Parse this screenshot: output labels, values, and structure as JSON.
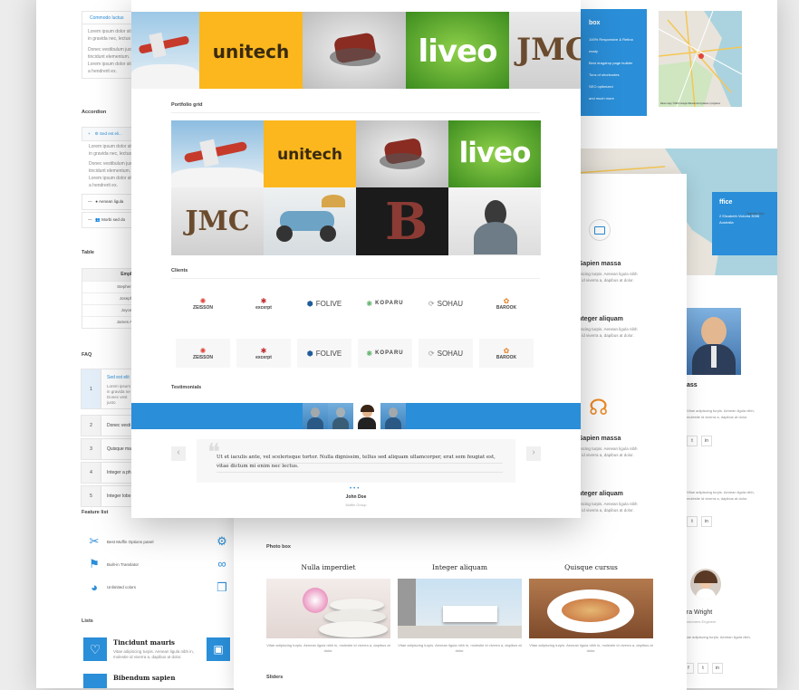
{
  "back_left": {
    "tab_label": "Commodo luctus",
    "tab_text_1": "Lorem ipsum dolor sit amet,",
    "tab_text_2": "in gravida nec, lectus",
    "tab_text_3": "Donec vestibulum justo",
    "tab_text_4": "tincidunt elementum.",
    "tab_text_5": "Lorem ipsum dolor sit",
    "tab_text_6": "a hendrerit ex.",
    "accordion_title": "Accordion",
    "accordion_item_1": "Sed est eli...",
    "accordion_text_1": "Lorem ipsum dolor sit",
    "accordion_text_2": "in gravida nec, lectus",
    "accordion_text_3": "Donec vestibulum justo",
    "accordion_text_4": "tincidunt elementum. Sl",
    "accordion_text_5": "Lorem ipsum dolor sit",
    "accordion_text_6": "a hendrerit ex.",
    "accordion_item_2": "Aenean ligula",
    "accordion_item_3": "Morbi sed do",
    "table_title": "Table",
    "table_header": "Employee",
    "table_rows": [
      "Stephen C. Cox",
      "Josephin Tan",
      "Joyce Ming",
      "James A. Pentel"
    ],
    "faq_title": "FAQ",
    "faq_items": [
      {
        "num": "1",
        "label": "Sed est elit"
      },
      {
        "num": "2",
        "label": "Donec vesti"
      },
      {
        "num": "3",
        "label": "Quisque ma"
      },
      {
        "num": "4",
        "label": "Integer a ph"
      },
      {
        "num": "5",
        "label": "Integer lobo"
      }
    ],
    "faq_answer_1": "Lorem ipsum",
    "faq_answer_2": "in gravida ne",
    "faq_answer_3": "Donec vest",
    "faq_answer_4": "justo",
    "feature_title": "Feature list",
    "features": [
      "Best Muffin Options panel",
      "Built-in Translator",
      "Unlimited colors",
      "Easy and Test M",
      "Unlimited layouts",
      "Outstanding docu"
    ],
    "lists_title": "Lists",
    "list_item_1": "Tincidunt mauris",
    "list_item_1_text": "Vitae adipiscing turpis. Aenean ligula nibh in,",
    "list_item_1_text2": "molestie id viverra a, dapibus at dolor.",
    "list_item_2": "Bibendum sapien"
  },
  "back_right": {
    "box_title": "box",
    "box_items": [
      "100% Responsive & Retina ready",
      "Best dragdrop page builder",
      "Tons of shortcodes",
      "SEO optimized",
      "and much more"
    ],
    "office_title": "ffice",
    "office_text": "2 Elizabeth Victoria 3006 Australia",
    "map_attribution": "Dane mapy ©2016 Google   Warunki korzystania z programu",
    "map_label": "Tasman Sea",
    "team_name_1": "ass",
    "team_text_1": "Vitae adipiscing turpis. Aenean ligula nibh,",
    "team_text_1b": "molestie id viverra a, dapibus at dolor.",
    "team_name_2": "ura Wright",
    "team_role_2": "Customers Engineer"
  },
  "mid": {
    "svc": [
      {
        "title": "Sapien massa",
        "d1": "Vitae adipiscing turpis. Aenean ligula nibh",
        "d2": "molestie id viverra a, dapibus at dolor."
      },
      {
        "title": "Integer aliquam",
        "d1": "Vitae adipiscing turpis. Aenean ligula nibh",
        "d2": "molestie id viverra a, dapibus at dolor."
      },
      {
        "title": "Sapien massa",
        "d1": "Vitae adipiscing turpis. Aenean ligula nibh",
        "d2": "molestie id viverra a, dapibus at dolor."
      },
      {
        "title": "Integer aliquam",
        "d1": "Vitae adipiscing turpis. Aenean ligula nibh",
        "d2": "molestie id viverra a, dapibus at dolor."
      }
    ],
    "photo_box_title": "Photo box",
    "photo_boxes": [
      {
        "title": "Nulla imperdiet",
        "text": "Vitae adipiscing turpis. Aenean ligula nibh in, molestie id viverra a, dapibus at dolor."
      },
      {
        "title": "Integer aliquam",
        "text": "Vitae adipiscing turpis. Aenean ligula nibh in, molestie id viverra a, dapibus at dolor."
      },
      {
        "title": "Quisque cursus",
        "text": "Vitae adipiscing turpis. Aenean ligula nibh in, molestie id viverra a, dapibus at dolor."
      }
    ],
    "bottom_label": "Sliders"
  },
  "front": {
    "top_logos": [
      "unitech",
      "liveo",
      "JMC"
    ],
    "portfolio_title": "Portfolio grid",
    "grid_logos": [
      "unitech",
      "liveo",
      "JMC"
    ],
    "clients_title": "Clients",
    "clients": [
      "ZEISSON",
      "excerpt",
      "FOLIVE",
      "KOPARU",
      "SOHAU",
      "BAROOK",
      "ZEISSON",
      "excerpt",
      "FOLIVE",
      "KOPARU",
      "SOHAU",
      "BAROOK"
    ],
    "testimonials_title": "Testimonials",
    "testimonial_quote": "Ut et iaculis ante, vel scelerisque tortor. Nulla dignissim, tellus sed aliquam ullamcorper, erat sem feugiat est, vitae dictum mi enim nec lectus.",
    "testimonial_author": "John Doe",
    "testimonial_company": "Muffin Group",
    "prev_arrow": "‹",
    "next_arrow": "›"
  },
  "colors": {
    "accent": "#2a8ed8",
    "yellow": "#fbb71d",
    "green": "#6eb52c",
    "orange": "#f08a24"
  }
}
